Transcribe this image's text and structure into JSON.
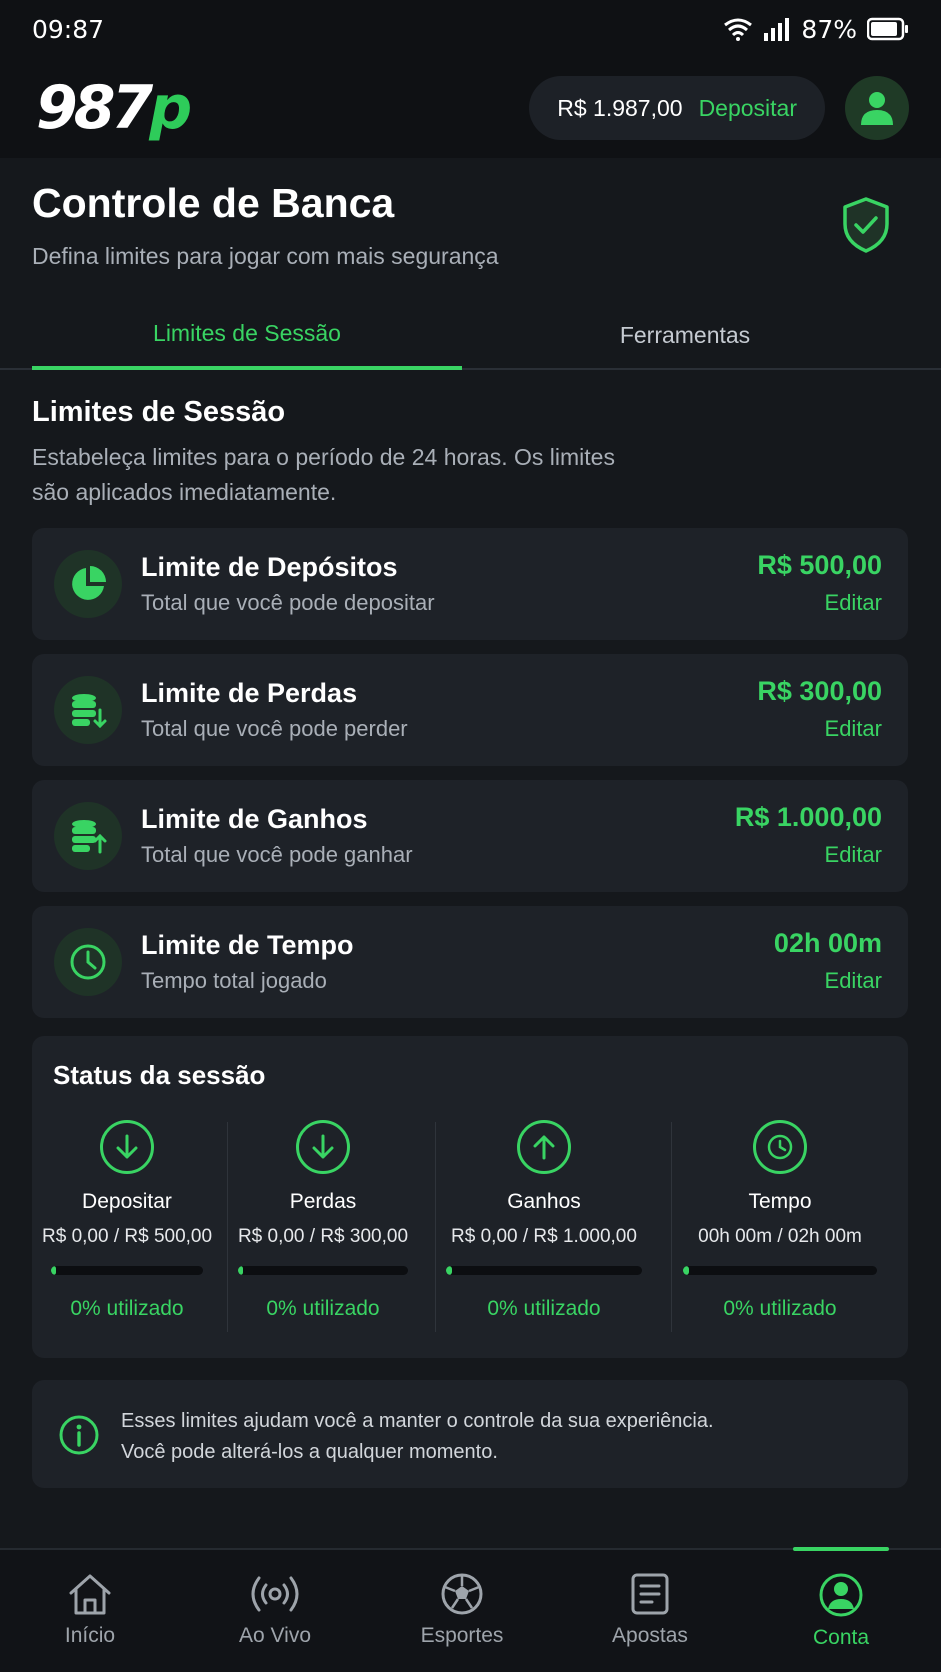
{
  "status_bar": {
    "time": "09:87",
    "battery": "87%"
  },
  "top_bar": {
    "logo_main": "987",
    "logo_accent": "p",
    "balance": "R$ 1.987,00",
    "deposit_label": "Depositar"
  },
  "header": {
    "title": "Controle de Banca",
    "subtitle": "Defina limites para jogar com mais segurança"
  },
  "tabs": [
    {
      "label": "Limites de Sessão",
      "active": true
    },
    {
      "label": "Ferramentas",
      "active": false
    }
  ],
  "section": {
    "title": "Limites de Sessão",
    "desc_line1": "Estabeleça limites para o período de 24 horas. Os limites",
    "desc_line2": "são aplicados imediatamente."
  },
  "limits": [
    {
      "icon": "pie-chart-icon",
      "title": "Limite de Depósitos",
      "subtitle": "Total que você pode depositar",
      "value": "R$ 500,00",
      "edit": "Editar"
    },
    {
      "icon": "coins-down-icon",
      "title": "Limite de Perdas",
      "subtitle": "Total que você pode perder",
      "value": "R$ 300,00",
      "edit": "Editar"
    },
    {
      "icon": "coins-up-icon",
      "title": "Limite de Ganhos",
      "subtitle": "Total que você pode ganhar",
      "value": "R$ 1.000,00",
      "edit": "Editar"
    },
    {
      "icon": "clock-icon",
      "title": "Limite de Tempo",
      "subtitle": "Tempo total jogado",
      "value": "02h 00m",
      "edit": "Editar"
    }
  ],
  "session_status": {
    "title": "Status da sessão",
    "items": [
      {
        "icon": "arrow-down-icon",
        "label": "Depositar",
        "value": "R$ 0,00 / R$ 500,00",
        "progress": 0.03,
        "percent_text": "0% utilizado"
      },
      {
        "icon": "arrow-down-icon",
        "label": "Perdas",
        "value": "R$ 0,00 / R$ 300,00",
        "progress": 0.03,
        "percent_text": "0% utilizado"
      },
      {
        "icon": "arrow-up-icon",
        "label": "Ganhos",
        "value": "R$ 0,00 / R$ 1.000,00",
        "progress": 0.03,
        "percent_text": "0% utilizado"
      },
      {
        "icon": "clock-icon",
        "label": "Tempo",
        "value": "00h 00m / 02h 00m",
        "progress": 0.03,
        "percent_text": "0% utilizado"
      }
    ]
  },
  "info": {
    "line1": "Esses limites ajudam você a manter o controle da sua experiência.",
    "line2": "Você pode alterá-los a qualquer momento."
  },
  "nav": [
    {
      "icon": "home-icon",
      "label": "Início",
      "active": false
    },
    {
      "icon": "live-icon",
      "label": "Ao Vivo",
      "active": false
    },
    {
      "icon": "soccer-ball-icon",
      "label": "Esportes",
      "active": false
    },
    {
      "icon": "bets-icon",
      "label": "Apostas",
      "active": false
    },
    {
      "icon": "account-icon",
      "label": "Conta",
      "active": true
    }
  ],
  "colors": {
    "accent": "#39d463",
    "background": "#15181c",
    "card": "#1e2228"
  }
}
